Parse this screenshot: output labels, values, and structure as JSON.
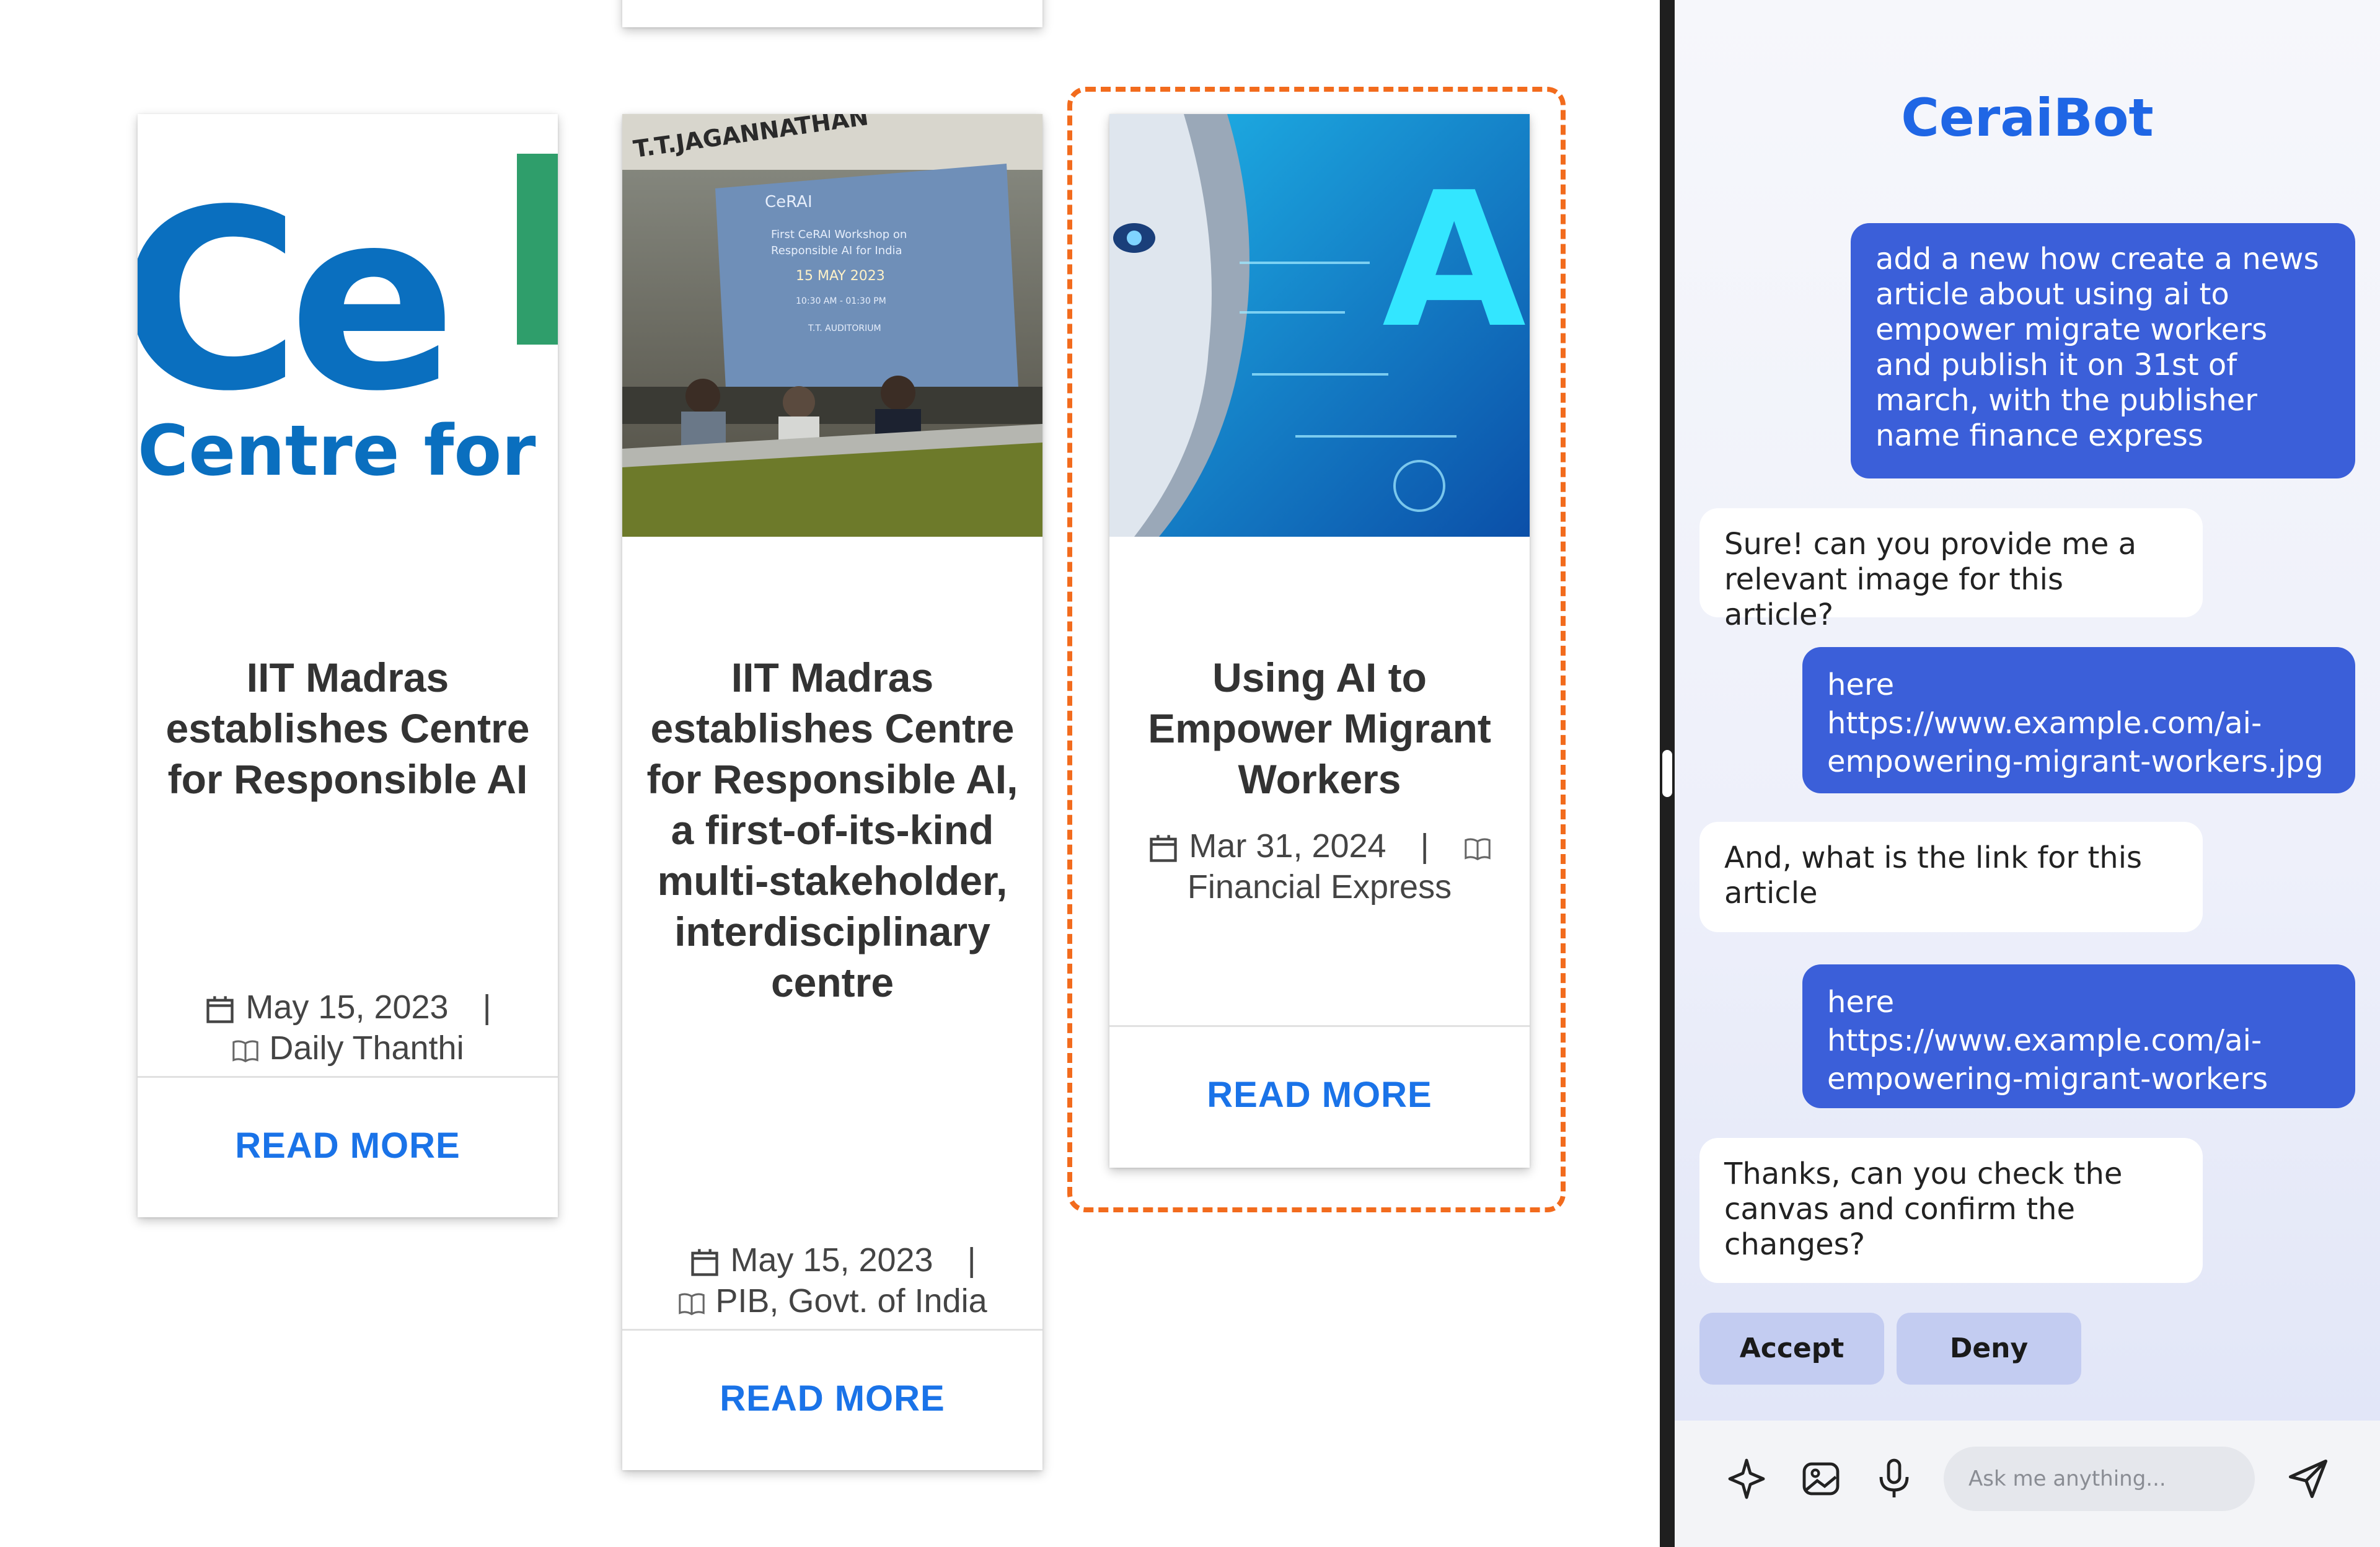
{
  "cards": [
    {
      "title": "IIT Madras establishes Centre for Responsible AI",
      "date": "May 15, 2023",
      "separator": "|",
      "publisher": "Daily Thanthi",
      "read_more": "READ MORE",
      "image_logo_text": "Ce",
      "image_logo_subtext": "Centre for R"
    },
    {
      "title": "IIT Madras establishes Centre for Responsible AI, a first-of-its-kind multi-stakeholder, interdisciplinary centre",
      "date": "May 15, 2023",
      "separator": "|",
      "publisher": "PIB, Govt. of India",
      "read_more": "READ MORE",
      "image_banner_text": "T.T.JAGANNATHAN",
      "image_screen_lines": [
        "CeRAI",
        "First CeRAI Workshop on",
        "Responsible AI for India",
        "15 MAY 2023",
        "10:30 AM - 01:30 PM",
        "T.T. AUDITORIUM"
      ]
    },
    {
      "title": "Using AI to Empower Migrant Workers",
      "date": "Mar 31, 2024",
      "separator": "|",
      "publisher": "Financial Express",
      "read_more": "READ MORE",
      "image_letter": "A"
    }
  ],
  "chat": {
    "title": "CeraiBot",
    "messages": [
      {
        "role": "user",
        "text": "add a new how create a news article about using ai to empower migrate workers and publish it on 31st of march, with the publisher name finance express"
      },
      {
        "role": "bot",
        "text": "Sure! can you provide me a relevant image for this article?"
      },
      {
        "role": "user",
        "text": "here https://www.example.com/ai-empowering-migrant-workers.jpg"
      },
      {
        "role": "bot",
        "text": "And, what is the link for this article"
      },
      {
        "role": "user",
        "text": "here https://www.example.com/ai-empowering-migrant-workers"
      },
      {
        "role": "bot",
        "text": "Thanks, can you check the canvas and confirm the changes?"
      }
    ],
    "accept_label": "Accept",
    "deny_label": "Deny",
    "input_placeholder": "Ask me anything...",
    "footer_icons": [
      "sparkle-icon",
      "image-icon",
      "microphone-icon",
      "send-icon"
    ]
  },
  "colors": {
    "accent": "#1f66e5",
    "user_bubble": "#3b5fd9",
    "read_more": "#1a73e8",
    "selection_outline": "#f26b1d",
    "button_bg": "#c3ccf1"
  }
}
